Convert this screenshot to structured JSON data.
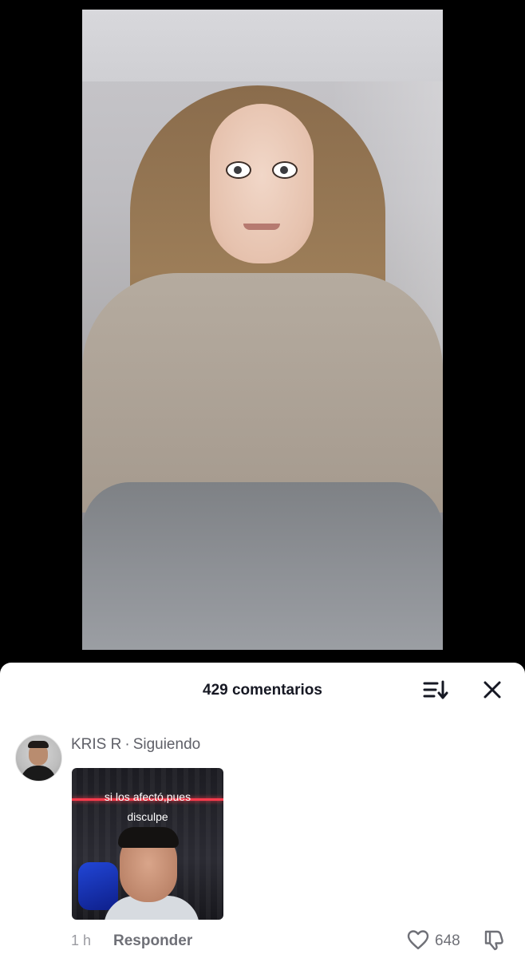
{
  "comments_sheet": {
    "title": "429 comentarios"
  },
  "comment": {
    "username": "KRIS R",
    "relation": "Siguiendo",
    "sticker_caption_line1": "si los afectó,pues",
    "sticker_caption_line2": "disculpe",
    "time": "1 h",
    "reply_label": "Responder",
    "like_count": "648"
  },
  "icons": {
    "sort": "sort-icon",
    "close": "close-icon",
    "like": "heart-icon",
    "dislike": "dislike-icon"
  }
}
